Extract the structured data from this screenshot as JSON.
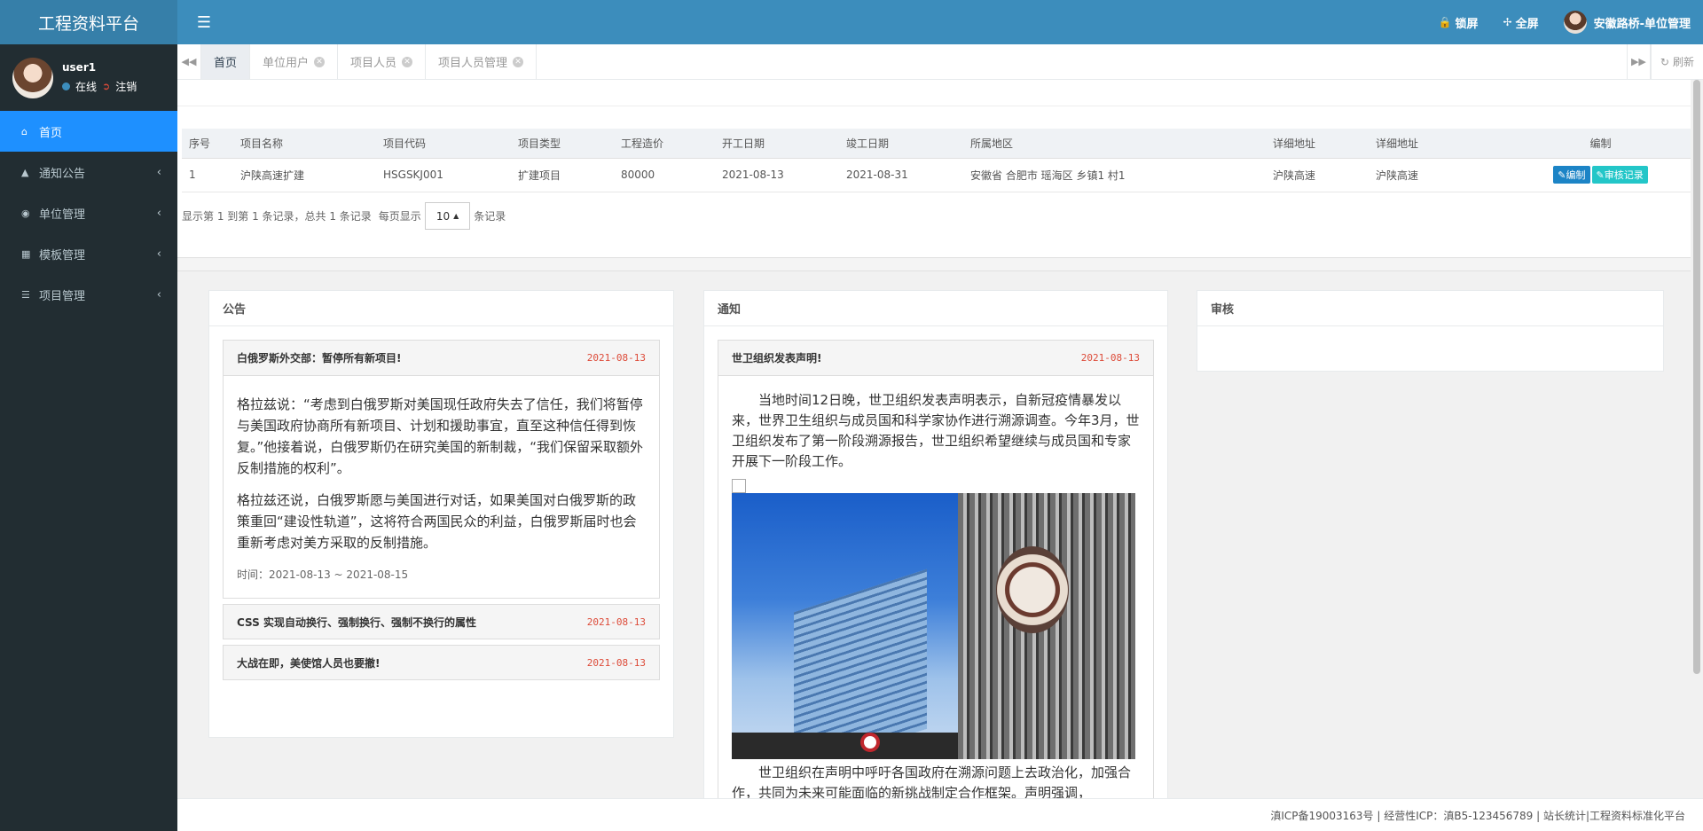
{
  "header": {
    "logo": "工程资料平台",
    "lock_label": "锁屏",
    "fullscreen_label": "全屏",
    "user_label": "安徽路桥-单位管理"
  },
  "sidebar": {
    "username": "user1",
    "status": "在线",
    "logout": "注销",
    "items": [
      {
        "label": "首页",
        "icon": "home-icon"
      },
      {
        "label": "通知公告",
        "icon": "warning-icon"
      },
      {
        "label": "单位管理",
        "icon": "eye-icon"
      },
      {
        "label": "模板管理",
        "icon": "template-icon"
      },
      {
        "label": "项目管理",
        "icon": "list-icon"
      }
    ]
  },
  "tabs": [
    {
      "label": "首页"
    },
    {
      "label": "单位用户"
    },
    {
      "label": "项目人员"
    },
    {
      "label": "项目人员管理"
    }
  ],
  "tab_refresh": "刷新",
  "table": {
    "headers": [
      "序号",
      "项目名称",
      "项目代码",
      "项目类型",
      "工程造价",
      "开工日期",
      "竣工日期",
      "所属地区",
      "详细地址",
      "详细地址",
      "编制"
    ],
    "rows": [
      [
        "1",
        "沪陕高速扩建",
        "HSGSKJ001",
        "扩建项目",
        "80000",
        "2021-08-13",
        "2021-08-31",
        "安徽省 合肥市 瑶海区 乡镇1 村1",
        "沪陕高速",
        "沪陕高速"
      ]
    ],
    "edit_label": "编制",
    "audit_label": "审核记录"
  },
  "pager": {
    "summary": "显示第 1 到第 1 条记录，总共 1 条记录",
    "per_page_prefix": "每页显示",
    "page_size": "10",
    "per_page_suffix": "条记录"
  },
  "panels": {
    "announcement": {
      "title": "公告",
      "items": [
        {
          "title": "白俄罗斯外交部：暂停所有新项目!",
          "date": "2021-08-13",
          "paragraphs": [
            "格拉兹说：“考虑到白俄罗斯对美国现任政府失去了信任，我们将暂停与美国政府协商所有新项目、计划和援助事宜，直至这种信任得到恢复。”他接着说，白俄罗斯仍在研究美国的新制裁，“我们保留采取额外反制措施的权利”。",
            "格拉兹还说，白俄罗斯愿与美国进行对话，如果美国对白俄罗斯的政策重回“建设性轨道”，这将符合两国民众的利益，白俄罗斯届时也会重新考虑对美方采取的反制措施。"
          ],
          "time": "时间：2021-08-13 ~ 2021-08-15"
        },
        {
          "title": "CSS 实现自动换行、强制换行、强制不换行的属性",
          "date": "2021-08-13"
        },
        {
          "title": "大战在即，美使馆人员也要撤!",
          "date": "2021-08-13"
        }
      ]
    },
    "notice": {
      "title": "通知",
      "item_title": "世卫组织发表声明!",
      "item_date": "2021-08-13",
      "para1": "当地时间12日晚，世卫组织发表声明表示，自新冠疫情暴发以来，世界卫生组织与成员国和科学家协作进行溯源调查。今年3月，世卫组织发布了第一阶段溯源报告，世卫组织希望继续与成员国和专家开展下一阶段工作。",
      "para2": "世卫组织在声明中呼吁各国政府在溯源问题上去政治化，加强合作，共同为未来可能面临的新挑战制定合作框架。声明强调，"
    },
    "audit": {
      "title": "审核"
    }
  },
  "footer": "滇ICP备19003163号 | 经营性ICP：滇B5-123456789 | 站长统计|工程资料标准化平台"
}
